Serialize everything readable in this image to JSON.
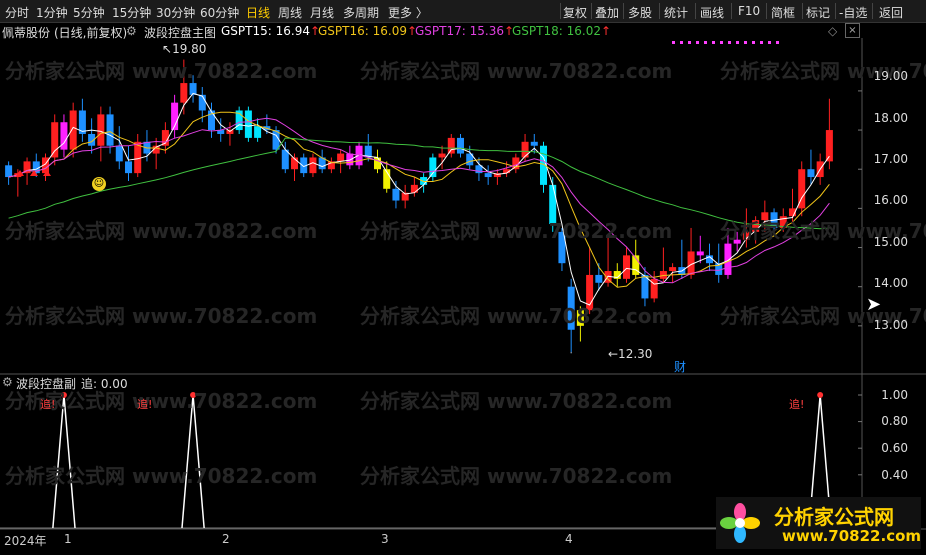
{
  "toolbar": {
    "periods": [
      "分时",
      "1分钟",
      "5分钟",
      "15分钟",
      "30分钟",
      "60分钟",
      "日线",
      "周线",
      "月线",
      "多周期",
      "更多 〉"
    ],
    "active_period": "日线",
    "right_buttons": [
      "复权",
      "叠加",
      "多股",
      "统计",
      "画线",
      "F10",
      "简框",
      "标记",
      "-自选",
      "返回"
    ]
  },
  "main_panel": {
    "stock_name": "佩蒂股份",
    "chart_mode": "(日线,前复权)",
    "indicator_name": "波段控盘主图",
    "indicators": [
      {
        "label": "GSPT15: 16.94",
        "arrow": "↑",
        "color": "#ffffff"
      },
      {
        "label": "GSPT16: 16.09",
        "arrow": "↑",
        "color": "#f0c419"
      },
      {
        "label": "GSPT17: 15.36",
        "arrow": "↑",
        "color": "#e040e0"
      },
      {
        "label": "GSPT18: 16.02",
        "arrow": "↑",
        "color": "#40c040"
      }
    ],
    "high_mark": "19.80",
    "low_mark": "←12.30",
    "finance_mark": "财",
    "y_ticks": [
      "19.00",
      "18.00",
      "17.00",
      "16.00",
      "15.00",
      "14.00",
      "13.00"
    ]
  },
  "sub_panel": {
    "indicator_name": "波段控盘副",
    "value_label": "追: 0.00",
    "signal_label": "追!",
    "y_ticks": [
      "1.00",
      "0.80",
      "0.60",
      "0.40"
    ]
  },
  "date_axis": {
    "labels": [
      "2024年",
      "1",
      "2",
      "3",
      "4"
    ]
  },
  "watermark": "分析家公式网 www.70822.com",
  "logo": {
    "text": "分析家公式网",
    "url": "www.70822.com"
  },
  "colors": {
    "up": "#ff2020",
    "down": "#1e90ff",
    "cyan": "#00e5ff",
    "yellow": "#f0f000",
    "magenta": "#ff20ff",
    "ma_white": "#ffffff",
    "ma_yellow": "#f0c419",
    "ma_magenta": "#e040e0",
    "ma_green": "#40c040"
  },
  "chart_data": {
    "type": "candlestick",
    "series": [
      {
        "name": "GSPT15",
        "color": "#ffffff"
      },
      {
        "name": "GSPT16",
        "color": "#f0c419"
      },
      {
        "name": "GSPT17",
        "color": "#e040e0"
      },
      {
        "name": "GSPT18",
        "color": "#40c040"
      }
    ],
    "ohlc": [
      [
        17.1,
        17.2,
        16.6,
        16.8
      ],
      [
        16.8,
        17.0,
        16.3,
        16.9
      ],
      [
        16.9,
        17.3,
        16.6,
        17.2
      ],
      [
        17.2,
        17.4,
        16.8,
        16.9
      ],
      [
        16.9,
        17.4,
        16.7,
        17.3
      ],
      [
        17.3,
        18.4,
        17.1,
        18.2
      ],
      [
        18.2,
        18.4,
        17.3,
        17.5
      ],
      [
        17.5,
        18.7,
        17.3,
        18.5
      ],
      [
        18.5,
        18.8,
        17.7,
        17.9
      ],
      [
        17.9,
        18.3,
        17.4,
        17.6
      ],
      [
        17.6,
        18.6,
        17.2,
        18.4
      ],
      [
        18.4,
        18.6,
        17.4,
        17.6
      ],
      [
        17.6,
        18.1,
        17.0,
        17.2
      ],
      [
        17.2,
        17.6,
        16.7,
        16.9
      ],
      [
        16.9,
        17.9,
        16.8,
        17.7
      ],
      [
        17.7,
        18.0,
        17.2,
        17.4
      ],
      [
        17.4,
        17.8,
        17.0,
        17.6
      ],
      [
        17.6,
        18.2,
        17.4,
        18.0
      ],
      [
        18.0,
        18.9,
        17.8,
        18.7
      ],
      [
        18.7,
        19.8,
        18.4,
        19.2
      ],
      [
        19.2,
        19.4,
        18.7,
        18.9
      ],
      [
        18.9,
        19.1,
        18.2,
        18.5
      ],
      [
        18.5,
        18.7,
        17.8,
        18.0
      ],
      [
        18.0,
        18.3,
        17.7,
        17.9
      ],
      [
        17.9,
        18.2,
        17.6,
        18.0
      ],
      [
        18.0,
        18.6,
        17.9,
        18.5
      ],
      [
        18.5,
        18.6,
        17.7,
        17.8
      ],
      [
        17.8,
        18.3,
        17.7,
        18.1
      ],
      [
        18.1,
        18.4,
        17.9,
        18.0
      ],
      [
        18.0,
        18.1,
        17.4,
        17.5
      ],
      [
        17.5,
        17.7,
        16.9,
        17.0
      ],
      [
        17.0,
        17.4,
        16.7,
        17.3
      ],
      [
        17.3,
        17.4,
        16.8,
        16.9
      ],
      [
        16.9,
        17.4,
        16.8,
        17.3
      ],
      [
        17.3,
        17.5,
        16.9,
        17.0
      ],
      [
        17.0,
        17.3,
        16.9,
        17.2
      ],
      [
        17.2,
        17.5,
        16.9,
        17.4
      ],
      [
        17.4,
        17.6,
        17.0,
        17.1
      ],
      [
        17.1,
        17.7,
        17.0,
        17.6
      ],
      [
        17.6,
        17.9,
        17.2,
        17.3
      ],
      [
        17.3,
        17.5,
        16.9,
        17.0
      ],
      [
        17.0,
        17.2,
        16.4,
        16.5
      ],
      [
        16.5,
        16.7,
        16.0,
        16.2
      ],
      [
        16.2,
        16.6,
        16.0,
        16.4
      ],
      [
        16.4,
        16.8,
        16.3,
        16.6
      ],
      [
        16.6,
        16.9,
        16.4,
        16.8
      ],
      [
        16.8,
        17.4,
        16.7,
        17.3
      ],
      [
        17.3,
        17.6,
        17.0,
        17.4
      ],
      [
        17.4,
        17.9,
        17.3,
        17.8
      ],
      [
        17.8,
        17.9,
        17.3,
        17.4
      ],
      [
        17.4,
        17.6,
        17.0,
        17.1
      ],
      [
        17.1,
        17.3,
        16.7,
        16.9
      ],
      [
        16.9,
        17.1,
        16.6,
        16.8
      ],
      [
        16.8,
        17.0,
        16.6,
        16.9
      ],
      [
        16.9,
        17.2,
        16.8,
        17.0
      ],
      [
        17.0,
        17.4,
        16.9,
        17.3
      ],
      [
        17.3,
        17.9,
        17.2,
        17.7
      ],
      [
        17.7,
        17.9,
        17.4,
        17.6
      ],
      [
        17.6,
        17.7,
        16.4,
        16.6
      ],
      [
        16.6,
        16.8,
        15.4,
        15.6
      ],
      [
        15.4,
        15.5,
        14.4,
        14.6
      ],
      [
        14.0,
        14.2,
        12.3,
        12.9
      ],
      [
        13.0,
        13.5,
        12.6,
        13.4
      ],
      [
        13.4,
        15.0,
        13.3,
        14.3
      ],
      [
        14.3,
        14.6,
        13.9,
        14.1
      ],
      [
        14.1,
        15.3,
        14.0,
        14.4
      ],
      [
        14.4,
        14.6,
        14.0,
        14.2
      ],
      [
        14.2,
        15.0,
        14.1,
        14.8
      ],
      [
        14.8,
        15.2,
        14.2,
        14.3
      ],
      [
        14.3,
        14.5,
        13.5,
        13.7
      ],
      [
        13.7,
        14.4,
        13.6,
        14.2
      ],
      [
        14.2,
        15.0,
        14.1,
        14.4
      ],
      [
        14.4,
        14.6,
        14.1,
        14.5
      ],
      [
        14.5,
        15.2,
        14.2,
        14.3
      ],
      [
        14.3,
        15.5,
        14.2,
        14.9
      ],
      [
        14.9,
        15.3,
        14.6,
        14.8
      ],
      [
        14.8,
        15.1,
        14.4,
        14.6
      ],
      [
        14.6,
        15.1,
        14.1,
        14.3
      ],
      [
        14.3,
        15.5,
        14.2,
        15.1
      ],
      [
        15.1,
        15.4,
        14.9,
        15.2
      ],
      [
        15.2,
        16.0,
        15.0,
        15.4
      ],
      [
        15.4,
        15.8,
        15.1,
        15.7
      ],
      [
        15.7,
        16.2,
        15.4,
        15.9
      ],
      [
        15.9,
        16.0,
        15.3,
        15.5
      ],
      [
        15.5,
        16.0,
        15.4,
        15.8
      ],
      [
        15.8,
        16.5,
        15.6,
        16.0
      ],
      [
        16.0,
        17.2,
        15.8,
        17.0
      ],
      [
        17.0,
        17.5,
        16.6,
        16.8
      ],
      [
        16.8,
        17.4,
        16.6,
        17.2
      ],
      [
        17.2,
        18.8,
        17.0,
        18.0
      ]
    ],
    "signal_bars": [
      6,
      20,
      88
    ],
    "ylim": [
      12.0,
      20.3
    ],
    "sub_ylim": [
      0,
      1.0
    ]
  }
}
